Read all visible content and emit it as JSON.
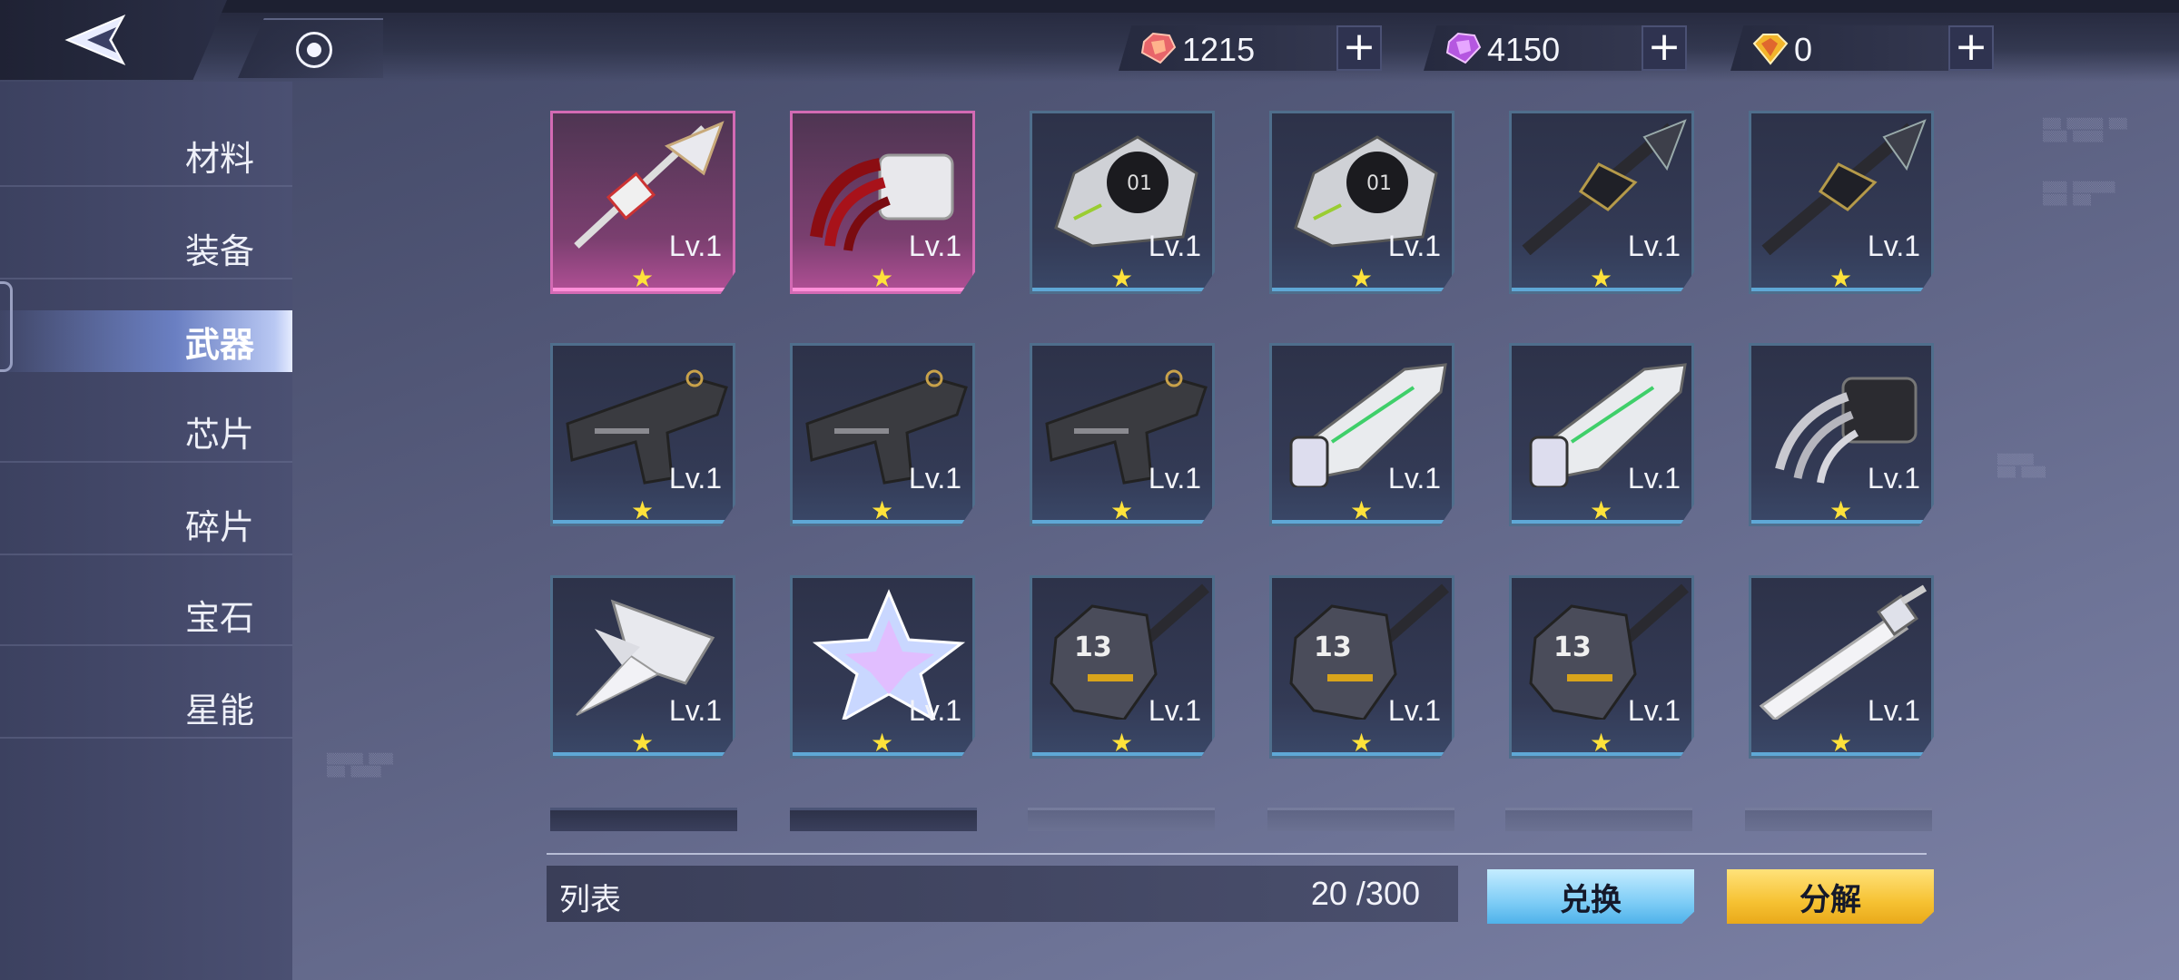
{
  "currencies": [
    {
      "name": "red-crystal",
      "value": "1215",
      "color": "#e8656a"
    },
    {
      "name": "purple-crystal",
      "value": "4150",
      "color": "#c56ae8"
    },
    {
      "name": "gold-gem",
      "value": "0",
      "color": "#f2b52b"
    }
  ],
  "plus_label": "+",
  "sidebar": {
    "items": [
      {
        "label": "材料",
        "active": false
      },
      {
        "label": "装备",
        "active": false
      },
      {
        "label": "武器",
        "active": true
      },
      {
        "label": "芯片",
        "active": false
      },
      {
        "label": "碎片",
        "active": false
      },
      {
        "label": "宝石",
        "active": false
      },
      {
        "label": "星能",
        "active": false
      }
    ]
  },
  "weapons": [
    {
      "icon": "spear-icon",
      "level": "Lv.1",
      "rarity": "pink",
      "stars": 1
    },
    {
      "icon": "red-claw-icon",
      "level": "Lv.1",
      "rarity": "pink",
      "stars": 1
    },
    {
      "icon": "cannon-01-icon",
      "level": "Lv.1",
      "rarity": "blue",
      "stars": 1
    },
    {
      "icon": "cannon-01-icon",
      "level": "Lv.1",
      "rarity": "blue",
      "stars": 1
    },
    {
      "icon": "dark-spear-icon",
      "level": "Lv.1",
      "rarity": "blue",
      "stars": 1
    },
    {
      "icon": "dark-spear-icon",
      "level": "Lv.1",
      "rarity": "blue",
      "stars": 1
    },
    {
      "icon": "pistol-icon",
      "level": "Lv.1",
      "rarity": "blue",
      "stars": 1
    },
    {
      "icon": "pistol-icon",
      "level": "Lv.1",
      "rarity": "blue",
      "stars": 1
    },
    {
      "icon": "pistol-icon",
      "level": "Lv.1",
      "rarity": "blue",
      "stars": 1
    },
    {
      "icon": "white-blaster-icon",
      "level": "Lv.1",
      "rarity": "blue",
      "stars": 1
    },
    {
      "icon": "white-blaster-icon",
      "level": "Lv.1",
      "rarity": "blue",
      "stars": 1
    },
    {
      "icon": "silver-claw-icon",
      "level": "Lv.1",
      "rarity": "blue",
      "stars": 1
    },
    {
      "icon": "white-blade-icon",
      "level": "Lv.1",
      "rarity": "blue",
      "stars": 1
    },
    {
      "icon": "crystal-star-icon",
      "level": "Lv.1",
      "rarity": "blue",
      "stars": 1
    },
    {
      "icon": "hammer-13-icon",
      "level": "Lv.1",
      "rarity": "blue",
      "stars": 1
    },
    {
      "icon": "hammer-13-icon",
      "level": "Lv.1",
      "rarity": "blue",
      "stars": 1
    },
    {
      "icon": "hammer-13-icon",
      "level": "Lv.1",
      "rarity": "blue",
      "stars": 1
    },
    {
      "icon": "white-sword-icon",
      "level": "Lv.1",
      "rarity": "blue",
      "stars": 1
    }
  ],
  "star_glyph": "★",
  "footer": {
    "list_label": "列表",
    "count": "20 /300",
    "exchange_label": "兑换",
    "decompose_label": "分解"
  }
}
